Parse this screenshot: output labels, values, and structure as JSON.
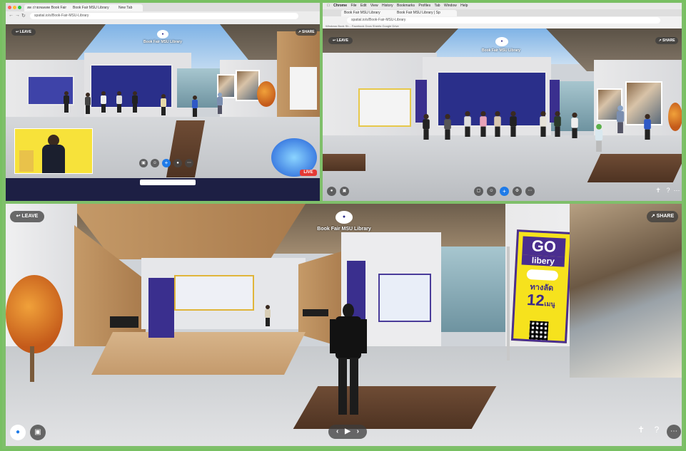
{
  "panel1": {
    "tabs": [
      "สด ถ่ายทอดสด Book Fair",
      "Book Fair MSU Library",
      "New Tab"
    ],
    "url": "spatial.io/s/Book-Fair-MSU-Library",
    "room_title": "Book Fair MSU Library",
    "leave": "LEAVE",
    "share": "SHARE",
    "live": "LIVE",
    "icons": [
      "leave-icon",
      "share-icon",
      "mic-icon",
      "camera-icon",
      "plus-icon",
      "emoji-icon",
      "more-icon"
    ]
  },
  "panel2": {
    "mac_menu": [
      "Chrome",
      "File",
      "Edit",
      "View",
      "History",
      "Bookmarks",
      "Profiles",
      "Tab",
      "Window",
      "Help"
    ],
    "tabs": [
      "Book Fair MSU Library",
      "Book Fair MSU Library | Sp"
    ],
    "url": "spatial.io/s/Book-Fair-MSU-Library",
    "bookmarks": "Windows Book Sh...  Facebook  Docs  Sheets  Google Drive",
    "room_title": "Book Fair MSU Library",
    "leave": "LEAVE",
    "share": "SHARE"
  },
  "panel3": {
    "room_title": "Book Fair MSU Library",
    "leave": "LEAVE",
    "share": "SHARE",
    "banner": {
      "line1": "GO",
      "line2": "libery",
      "line3": "ทางลัด",
      "line4": "12",
      "line5": "เมนู"
    }
  },
  "colors": {
    "frame": "#78c062",
    "accent_blue": "#1f7be8",
    "banner_yellow": "#f6e21d",
    "banner_purple": "#4a2e8f"
  }
}
